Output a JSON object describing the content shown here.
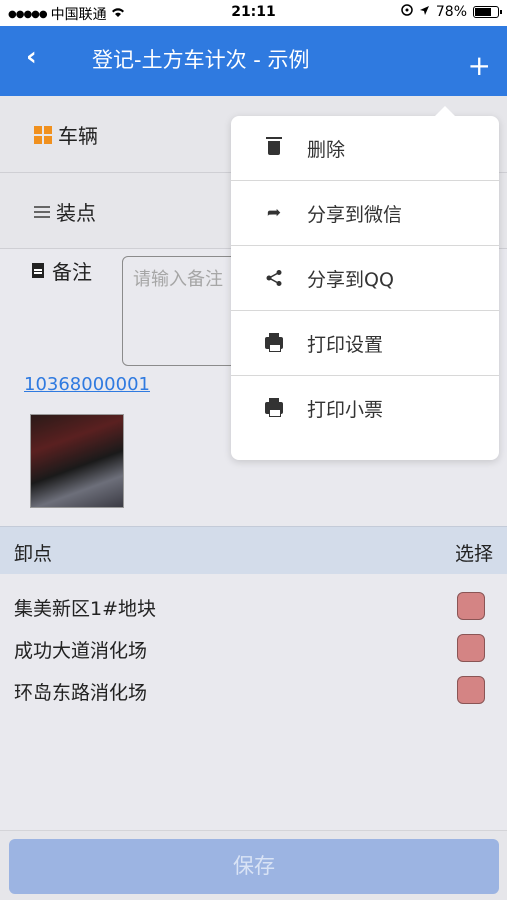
{
  "status_bar": {
    "signal_dots": "●●●●●",
    "carrier": "中国联通",
    "wifi_icon": "wifi-icon",
    "time": "21:11",
    "battery_percent": "78%",
    "battery_level": 0.78
  },
  "nav": {
    "back_icon": "chevron-left-icon",
    "back_glyph": "‹",
    "title": "登记-土方车计次 - 示例",
    "add_glyph": "+"
  },
  "form": {
    "vehicle_label": "车辆",
    "load_label": "装点",
    "remark_label": "备注",
    "remark_placeholder": "请输入备注",
    "phone": "10368000001"
  },
  "unload_section": {
    "header_left": "卸点",
    "header_right": "选择",
    "items": [
      {
        "name": "集美新区1#地块"
      },
      {
        "name": "成功大道消化场"
      },
      {
        "name": "环岛东路消化场"
      }
    ]
  },
  "save_label": "保存",
  "popover_menu": {
    "items": [
      {
        "label": "删除",
        "icon": "trash-icon"
      },
      {
        "label": "分享到微信",
        "icon": "share-arrow-icon",
        "glyph": "➦"
      },
      {
        "label": "分享到QQ",
        "icon": "share-nodes-icon",
        "glyph": "⋖"
      },
      {
        "label": "打印设置",
        "icon": "printer-icon"
      },
      {
        "label": "打印小票",
        "icon": "printer-icon"
      }
    ]
  },
  "colors": {
    "nav_blue": "#2f7ae0",
    "accent_orange": "#f0901e",
    "checkbox_red": "#d48484",
    "save_button": "#9cb4e2"
  }
}
